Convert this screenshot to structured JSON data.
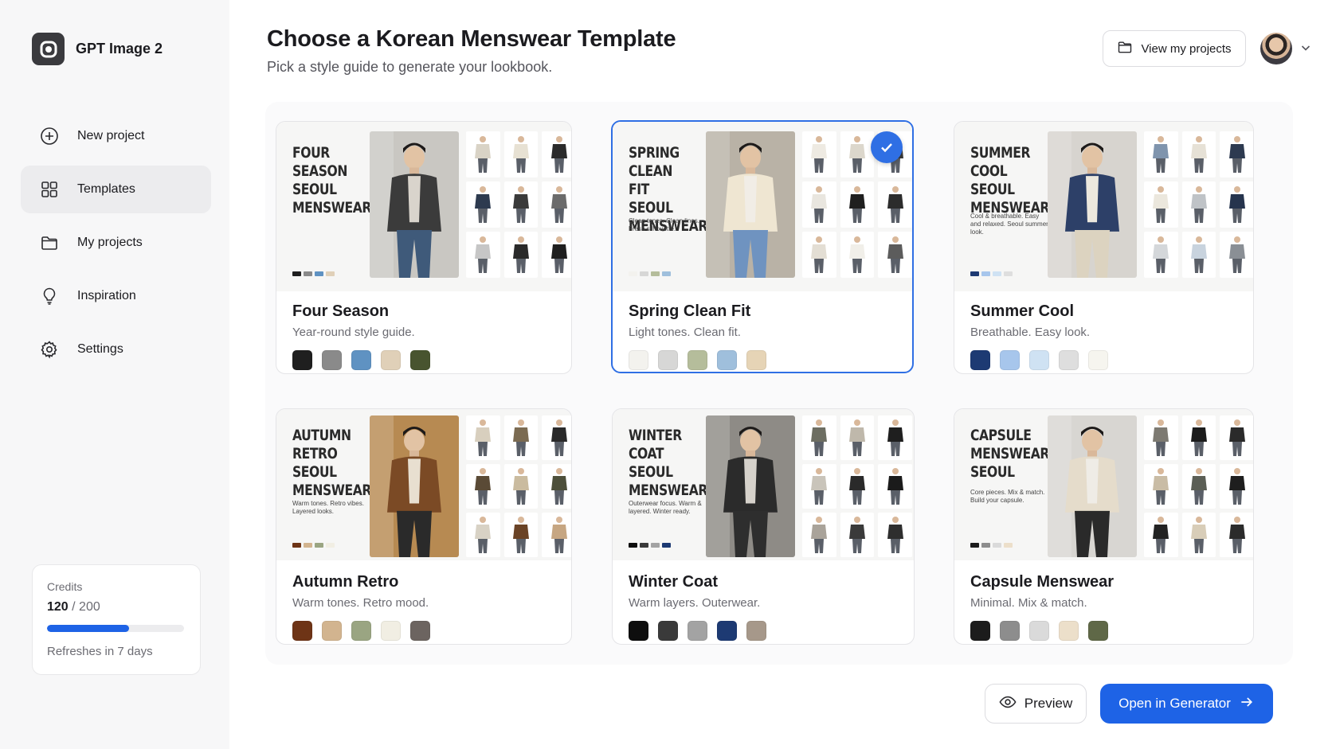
{
  "app": {
    "name": "GPT Image 2",
    "logo_icon": "openai-logo-icon"
  },
  "sidebar": {
    "items": [
      {
        "label": "New project",
        "icon": "plus-circle-icon",
        "active": false
      },
      {
        "label": "Templates",
        "icon": "grid-icon",
        "active": true
      },
      {
        "label": "My projects",
        "icon": "folder-icon",
        "active": false
      },
      {
        "label": "Inspiration",
        "icon": "lightbulb-icon",
        "active": false
      },
      {
        "label": "Settings",
        "icon": "gear-icon",
        "active": false
      }
    ]
  },
  "credits": {
    "title": "Credits",
    "used": "120",
    "total": "/ 200",
    "progress_fraction": 0.6,
    "refresh": "Refreshes in 7 days"
  },
  "header": {
    "title": "Choose a Korean Menswear Template",
    "subtitle": "Pick a style guide to generate your lookbook.",
    "projects_button": "View my projects"
  },
  "templates": [
    {
      "name": "Four Season",
      "description": "Year-round style guide.",
      "thumb_title": "FOUR SEASON SEOUL MENSWEAR",
      "thumb_note": "",
      "selected": false,
      "swatches": [
        "#1f1f1f",
        "#8a8a8a",
        "#5f92c2",
        "#e0d0b8",
        "#48542f"
      ]
    },
    {
      "name": "Spring Clean Fit",
      "description": "Light tones. Clean fit.",
      "thumb_title": "SPRING CLEAN FIT SEOUL MENSWEAR",
      "thumb_note": "Clean tones. Clean lines. Fresh silhouette.",
      "selected": true,
      "swatches": [
        "#f3f2ee",
        "#d7d7d6",
        "#b5bd9b",
        "#9fbfdc",
        "#e6d4b6"
      ]
    },
    {
      "name": "Summer Cool",
      "description": "Breathable. Easy look.",
      "thumb_title": "SUMMER COOL SEOUL MENSWEAR",
      "thumb_note": "Cool & breathable. Easy and relaxed. Seoul summer look.",
      "selected": false,
      "swatches": [
        "#1d3a73",
        "#a7c6ec",
        "#cfe2f3",
        "#dedede",
        "#f6f5ef"
      ]
    },
    {
      "name": "Autumn Retro",
      "description": "Warm tones. Retro mood.",
      "thumb_title": "AUTUMN RETRO SEOUL MENSWEAR",
      "thumb_note": "Warm tones. Retro vibes. Layered looks.",
      "selected": false,
      "swatches": [
        "#6e3416",
        "#d2b48f",
        "#9aa582",
        "#f1eee3",
        "#6c6460"
      ]
    },
    {
      "name": "Winter Coat",
      "description": "Warm layers. Outerwear.",
      "thumb_title": "WINTER COAT SEOUL MENSWEAR",
      "thumb_note": "Outerwear focus. Warm & layered. Winter ready.",
      "selected": false,
      "swatches": [
        "#0e0e0e",
        "#3a3a3a",
        "#a3a3a3",
        "#1d3a73",
        "#a6988a"
      ]
    },
    {
      "name": "Capsule Menswear",
      "description": "Minimal. Mix & match.",
      "thumb_title": "CAPSULE MENSWEAR SEOUL",
      "thumb_note": "Core pieces. Mix & match. Build your capsule.",
      "selected": false,
      "swatches": [
        "#1c1c1c",
        "#8d8d8d",
        "#dadada",
        "#ecdfca",
        "#5f6847"
      ]
    }
  ],
  "footer": {
    "preview_button": "Preview",
    "open_button": "Open in Generator"
  }
}
